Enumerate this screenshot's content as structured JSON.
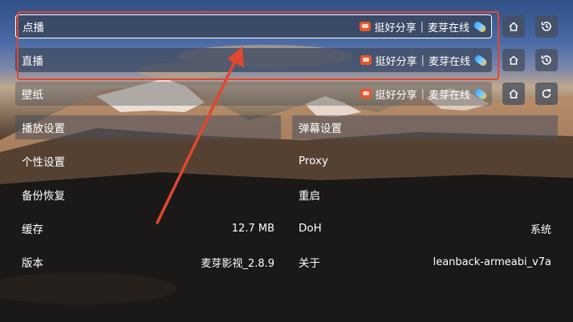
{
  "rows": {
    "vod": {
      "label": "点播",
      "site": "挺好分享",
      "source": "麦芽在线"
    },
    "live": {
      "label": "直播",
      "site": "挺好分享",
      "source": "麦芽在线"
    },
    "wallpaper": {
      "label": "壁纸",
      "site": "挺好分享",
      "source": "麦芽在线"
    }
  },
  "settings": {
    "left": [
      {
        "label": "播放设置",
        "value": ""
      },
      {
        "label": "个性设置",
        "value": ""
      },
      {
        "label": "备份恢复",
        "value": ""
      },
      {
        "label": "缓存",
        "value": "12.7 MB"
      },
      {
        "label": "版本",
        "value": "麦芽影视_2.8.9"
      }
    ],
    "right": [
      {
        "label": "弹幕设置",
        "value": ""
      },
      {
        "label": "Proxy",
        "value": ""
      },
      {
        "label": "重启",
        "value": ""
      },
      {
        "label": "DoH",
        "value": "系统"
      },
      {
        "label": "关于",
        "value": "leanback-armeabi_v7a"
      }
    ]
  },
  "icons": {
    "home": "home-icon",
    "history": "history-icon",
    "refresh": "refresh-icon",
    "site_badge": "tv-icon",
    "source_badge": "capsule-icon"
  },
  "colors": {
    "annotation": "#e3462f",
    "focus_border": "#ffffff"
  }
}
